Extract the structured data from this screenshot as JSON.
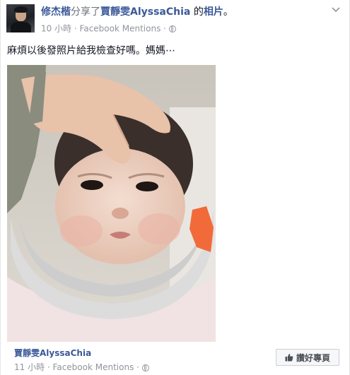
{
  "post": {
    "author": "修杰楷",
    "action_text": "分享了",
    "shared_from": "賈靜雯AlyssaChia",
    "possessive": " 的",
    "object": "相片",
    "period": "。",
    "time": "10 小時",
    "separator": " · ",
    "via": "Facebook Mentions",
    "caption": "麻煩以後發照片給我檢查好嗎。媽媽⋯",
    "options_icon": "chevron-down-icon",
    "privacy_icon": "globe-icon"
  },
  "attribution": {
    "page_name": "賈靜雯AlyssaChia",
    "time": "11 小時",
    "separator": " · ",
    "via": "Facebook Mentions",
    "like_button": "讚好專頁",
    "like_icon": "thumbs-up-icon"
  },
  "colors": {
    "link": "#3b5998",
    "muted": "#90949c",
    "text": "#141823"
  }
}
